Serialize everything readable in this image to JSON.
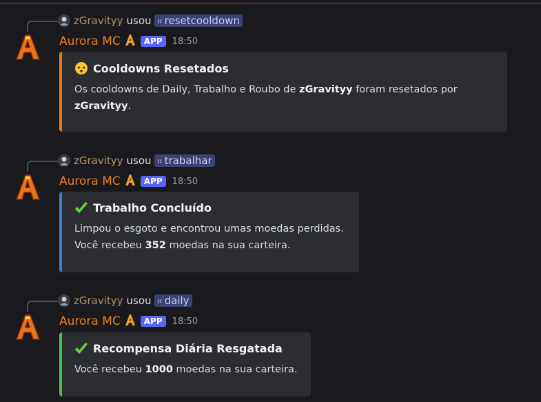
{
  "messages": [
    {
      "reply_user": "zGravityy",
      "reply_verb": "usou",
      "command": "resetcooldown",
      "author": "Aurora MC",
      "badge": "APP",
      "time": "18:50",
      "accent": "#e67e22",
      "title_icon": "dizzy-face-icon",
      "title": "Cooldowns Resetados",
      "desc_lines": [
        [
          "Os cooldowns de Daily, Trabalho e Roubo de ",
          "zGravityy",
          " foram resetados por"
        ],
        [
          "",
          "zGravityy",
          "."
        ]
      ]
    },
    {
      "reply_user": "zGravityy",
      "reply_verb": "usou",
      "command": "trabalhar",
      "author": "Aurora MC",
      "badge": "APP",
      "time": "18:50",
      "accent": "#3b82c4",
      "title_icon": "check-mark-icon",
      "title": "Trabalho Concluído",
      "desc_lines": [
        [
          "Limpou o esgoto e encontrou umas moedas perdidas.",
          "",
          ""
        ],
        [
          "Você recebeu ",
          "352",
          " moedas na sua carteira."
        ]
      ]
    },
    {
      "reply_user": "zGravityy",
      "reply_verb": "usou",
      "command": "daily",
      "author": "Aurora MC",
      "badge": "APP",
      "time": "18:50",
      "accent": "#4fbf5a",
      "title_icon": "check-mark-icon",
      "title": "Recompensa Diária Resgatada",
      "desc_lines": [
        [
          "Você recebeu ",
          "1000",
          " moedas na sua carteira."
        ]
      ]
    }
  ]
}
